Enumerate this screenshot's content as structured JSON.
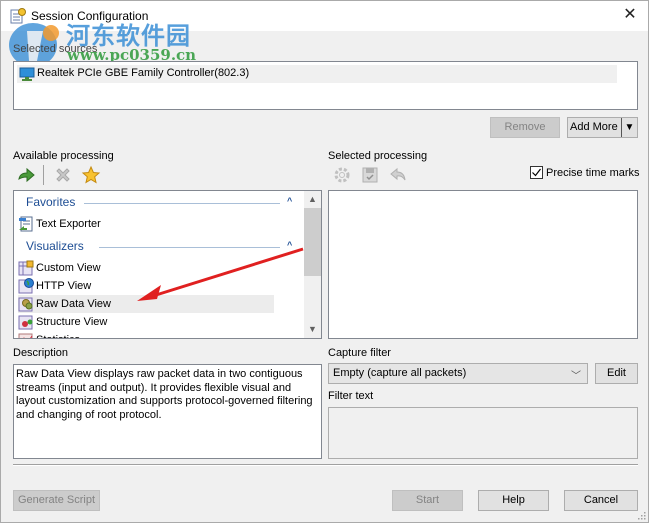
{
  "window": {
    "title": "Session Configuration",
    "close_label": "✕"
  },
  "watermark": {
    "line1": "河东软件园",
    "line2": "www.pc0359.cn"
  },
  "sources": {
    "label": "Selected sources",
    "items": [
      {
        "label": "Realtek PCIe GBE Family Controller(802.3)",
        "icon": "network-adapter-icon"
      }
    ],
    "remove_label": "Remove",
    "add_more_label": "Add More",
    "add_more_arrow": "▼"
  },
  "available": {
    "label": "Available processing",
    "groups": [
      {
        "title": "Favorites",
        "items": [
          {
            "label": "Text Exporter",
            "icon": "text-exporter-icon"
          }
        ]
      },
      {
        "title": "Visualizers",
        "items": [
          {
            "label": "Custom View",
            "icon": "custom-view-icon"
          },
          {
            "label": "HTTP View",
            "icon": "http-view-icon"
          },
          {
            "label": "Raw Data View",
            "icon": "raw-data-view-icon"
          },
          {
            "label": "Structure View",
            "icon": "structure-view-icon"
          },
          {
            "label": "Statistics",
            "icon": "statistics-icon"
          }
        ]
      }
    ],
    "collapse_glyph": "^"
  },
  "selected": {
    "label": "Selected processing",
    "precise_time_marks_label": "Precise time marks",
    "precise_time_marks_checked": true
  },
  "description": {
    "label": "Description",
    "text": "Raw Data View displays raw packet data in two contiguous streams (input and output). It provides flexible visual and layout customization and supports protocol-governed filtering and changing of root protocol."
  },
  "capture_filter": {
    "label": "Capture filter",
    "selected": "Empty (capture all packets)",
    "edit_label": "Edit",
    "filter_text_label": "Filter text",
    "filter_text_value": ""
  },
  "footer": {
    "generate_script_label": "Generate Script",
    "start_label": "Start",
    "help_label": "Help",
    "cancel_label": "Cancel"
  },
  "colors": {
    "group_header": "#1d4d94",
    "annotation_arrow": "#e02020"
  }
}
